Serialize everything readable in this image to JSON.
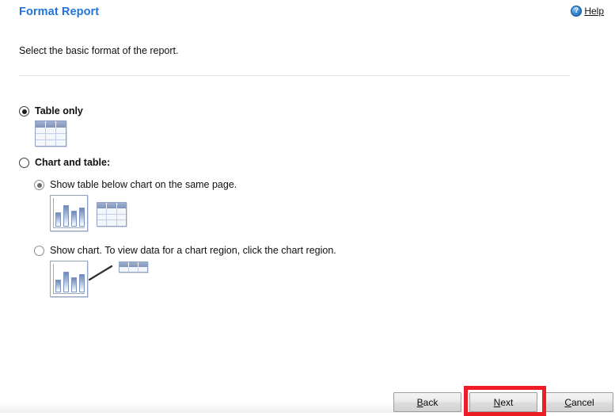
{
  "header": {
    "title": "Format Report",
    "help_label": "Help",
    "help_icon": "question-circle-icon",
    "title_color": "#2175D9"
  },
  "instruction": "Select the basic format of the report.",
  "options": [
    {
      "id": "table-only",
      "label": "Table only",
      "selected": true,
      "icons": [
        "table-icon"
      ]
    },
    {
      "id": "chart-and-table",
      "label": "Chart and table:",
      "selected": false,
      "sub_options": [
        {
          "id": "show-table-below-chart",
          "label": "Show table below chart on the same page.",
          "selected": true,
          "icons": [
            "bar-chart-icon",
            "table-icon"
          ]
        },
        {
          "id": "show-chart-click-region",
          "label": "Show chart. To view data for a chart region, click the chart region.",
          "selected": false,
          "icons": [
            "bar-chart-icon",
            "callout-arrow-icon",
            "table-icon"
          ]
        }
      ]
    }
  ],
  "chart_icon_bars": [
    18,
    27,
    20,
    24
  ],
  "chart_icon_bars_alt": [
    16,
    26,
    19,
    23
  ],
  "footer": {
    "buttons": [
      {
        "id": "back",
        "label": "Back",
        "mnemonic": "B",
        "rest": "ack",
        "highlighted": false
      },
      {
        "id": "next",
        "label": "Next",
        "mnemonic": "N",
        "rest": "ext",
        "highlighted": true
      },
      {
        "id": "cancel",
        "label": "Cancel",
        "mnemonic": "C",
        "rest": "ancel",
        "highlighted": false
      }
    ],
    "highlight_color": "#ee1c25"
  }
}
